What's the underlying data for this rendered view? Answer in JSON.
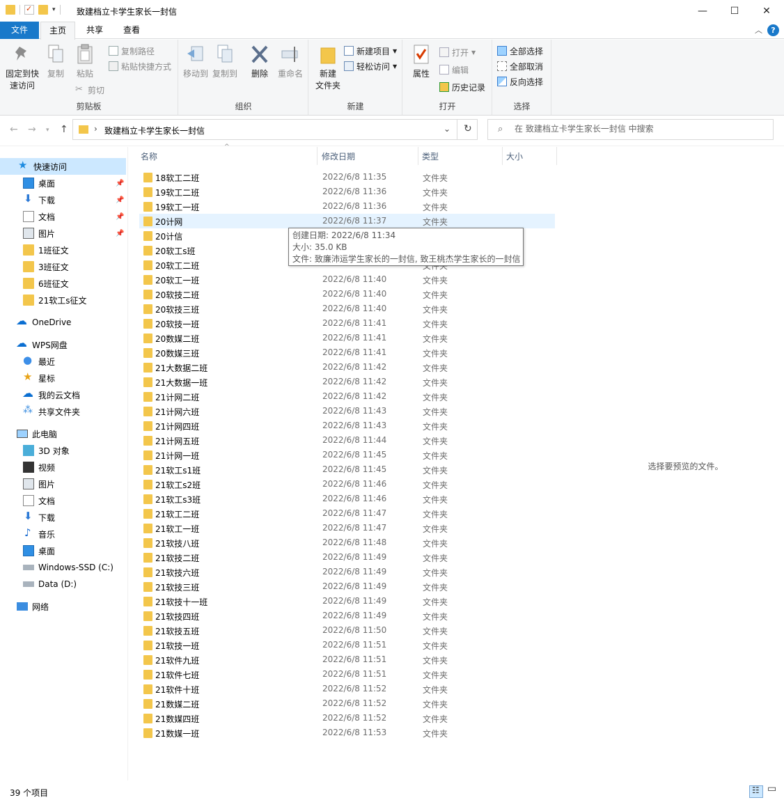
{
  "window": {
    "title": "致建档立卡学生家长一封信"
  },
  "ribbon_tabs": [
    "文件",
    "主页",
    "共享",
    "查看"
  ],
  "ribbon": {
    "clipboard": {
      "label": "剪贴板",
      "pin_line1": "固定到快",
      "pin_line2": "速访问",
      "copy": "复制",
      "paste": "粘贴",
      "copy_path": "复制路径",
      "paste_shortcut": "粘贴快捷方式",
      "cut": "剪切"
    },
    "organize": {
      "label": "组织",
      "move_to": "移动到",
      "copy_to": "复制到",
      "delete": "删除",
      "rename": "重命名"
    },
    "new": {
      "label": "新建",
      "new_folder_line1": "新建",
      "new_folder_line2": "文件夹",
      "new_item": "新建项目",
      "easy_access": "轻松访问"
    },
    "open": {
      "label": "打开",
      "properties": "属性",
      "open": "打开",
      "edit": "编辑",
      "history": "历史记录"
    },
    "select": {
      "label": "选择",
      "select_all": "全部选择",
      "select_none": "全部取消",
      "invert": "反向选择"
    }
  },
  "address": {
    "path": "致建档立卡学生家长一封信",
    "search_placeholder": "在 致建档立卡学生家长一封信 中搜索"
  },
  "sidebar": {
    "quick_access": "快速访问",
    "quick_items": [
      {
        "label": "桌面",
        "icon": "desktop-icon",
        "pinned": true
      },
      {
        "label": "下载",
        "icon": "download-icon",
        "pinned": true
      },
      {
        "label": "文档",
        "icon": "document-icon",
        "pinned": true
      },
      {
        "label": "图片",
        "icon": "picture-icon",
        "pinned": true
      },
      {
        "label": "1班征文",
        "icon": "folder-icon",
        "pinned": false
      },
      {
        "label": "3班征文",
        "icon": "folder-icon",
        "pinned": false
      },
      {
        "label": "6班征文",
        "icon": "folder-icon",
        "pinned": false
      },
      {
        "label": "21软工s征文",
        "icon": "folder-icon",
        "pinned": false
      }
    ],
    "onedrive": "OneDrive",
    "wps": "WPS网盘",
    "wps_items": [
      "最近",
      "星标",
      "我的云文档",
      "共享文件夹"
    ],
    "this_pc": "此电脑",
    "pc_items": [
      "3D 对象",
      "视频",
      "图片",
      "文档",
      "下载",
      "音乐",
      "桌面",
      "Windows-SSD (C:)",
      "Data (D:)"
    ],
    "network": "网络"
  },
  "columns": {
    "name": "名称",
    "date": "修改日期",
    "type": "类型",
    "size": "大小"
  },
  "files": [
    {
      "name": "18软工二班",
      "date": "2022/6/8 11:35",
      "type": "文件夹"
    },
    {
      "name": "19软工二班",
      "date": "2022/6/8 11:36",
      "type": "文件夹"
    },
    {
      "name": "19软工一班",
      "date": "2022/6/8 11:36",
      "type": "文件夹"
    },
    {
      "name": "20计网",
      "date": "2022/6/8 11:37",
      "type": "文件夹"
    },
    {
      "name": "20计信",
      "date": "",
      "type": ""
    },
    {
      "name": "20软工s班",
      "date": "",
      "type": ""
    },
    {
      "name": "20软工二班",
      "date": "",
      "type": "文件夹"
    },
    {
      "name": "20软工一班",
      "date": "2022/6/8 11:40",
      "type": "文件夹"
    },
    {
      "name": "20软技二班",
      "date": "2022/6/8 11:40",
      "type": "文件夹"
    },
    {
      "name": "20软技三班",
      "date": "2022/6/8 11:40",
      "type": "文件夹"
    },
    {
      "name": "20软技一班",
      "date": "2022/6/8 11:41",
      "type": "文件夹"
    },
    {
      "name": "20数媒二班",
      "date": "2022/6/8 11:41",
      "type": "文件夹"
    },
    {
      "name": "20数媒三班",
      "date": "2022/6/8 11:41",
      "type": "文件夹"
    },
    {
      "name": "21大数据二班",
      "date": "2022/6/8 11:42",
      "type": "文件夹"
    },
    {
      "name": "21大数据一班",
      "date": "2022/6/8 11:42",
      "type": "文件夹"
    },
    {
      "name": "21计网二班",
      "date": "2022/6/8 11:42",
      "type": "文件夹"
    },
    {
      "name": "21计网六班",
      "date": "2022/6/8 11:43",
      "type": "文件夹"
    },
    {
      "name": "21计网四班",
      "date": "2022/6/8 11:43",
      "type": "文件夹"
    },
    {
      "name": "21计网五班",
      "date": "2022/6/8 11:44",
      "type": "文件夹"
    },
    {
      "name": "21计网一班",
      "date": "2022/6/8 11:45",
      "type": "文件夹"
    },
    {
      "name": "21软工s1班",
      "date": "2022/6/8 11:45",
      "type": "文件夹"
    },
    {
      "name": "21软工s2班",
      "date": "2022/6/8 11:46",
      "type": "文件夹"
    },
    {
      "name": "21软工s3班",
      "date": "2022/6/8 11:46",
      "type": "文件夹"
    },
    {
      "name": "21软工二班",
      "date": "2022/6/8 11:47",
      "type": "文件夹"
    },
    {
      "name": "21软工一班",
      "date": "2022/6/8 11:47",
      "type": "文件夹"
    },
    {
      "name": "21软技八班",
      "date": "2022/6/8 11:48",
      "type": "文件夹"
    },
    {
      "name": "21软技二班",
      "date": "2022/6/8 11:49",
      "type": "文件夹"
    },
    {
      "name": "21软技六班",
      "date": "2022/6/8 11:49",
      "type": "文件夹"
    },
    {
      "name": "21软技三班",
      "date": "2022/6/8 11:49",
      "type": "文件夹"
    },
    {
      "name": "21软技十一班",
      "date": "2022/6/8 11:49",
      "type": "文件夹"
    },
    {
      "name": "21软技四班",
      "date": "2022/6/8 11:49",
      "type": "文件夹"
    },
    {
      "name": "21软技五班",
      "date": "2022/6/8 11:50",
      "type": "文件夹"
    },
    {
      "name": "21软技一班",
      "date": "2022/6/8 11:51",
      "type": "文件夹"
    },
    {
      "name": "21软件九班",
      "date": "2022/6/8 11:51",
      "type": "文件夹"
    },
    {
      "name": "21软件七班",
      "date": "2022/6/8 11:51",
      "type": "文件夹"
    },
    {
      "name": "21软件十班",
      "date": "2022/6/8 11:52",
      "type": "文件夹"
    },
    {
      "name": "21数媒二班",
      "date": "2022/6/8 11:52",
      "type": "文件夹"
    },
    {
      "name": "21数媒四班",
      "date": "2022/6/8 11:52",
      "type": "文件夹"
    },
    {
      "name": "21数媒一班",
      "date": "2022/6/8 11:53",
      "type": "文件夹"
    }
  ],
  "tooltip": {
    "created": "创建日期: 2022/6/8 11:34",
    "size": "大小: 35.0 KB",
    "files": "文件: 致廉沛运学生家长的一封信, 致王桃杰学生家长的一封信"
  },
  "preview_text": "选择要预览的文件。",
  "status": {
    "count": "39 个项目"
  },
  "colors": {
    "accent": "#1979ca",
    "folder": "#f3c64b",
    "selection": "#cce8ff",
    "hover": "#e5f3ff"
  }
}
